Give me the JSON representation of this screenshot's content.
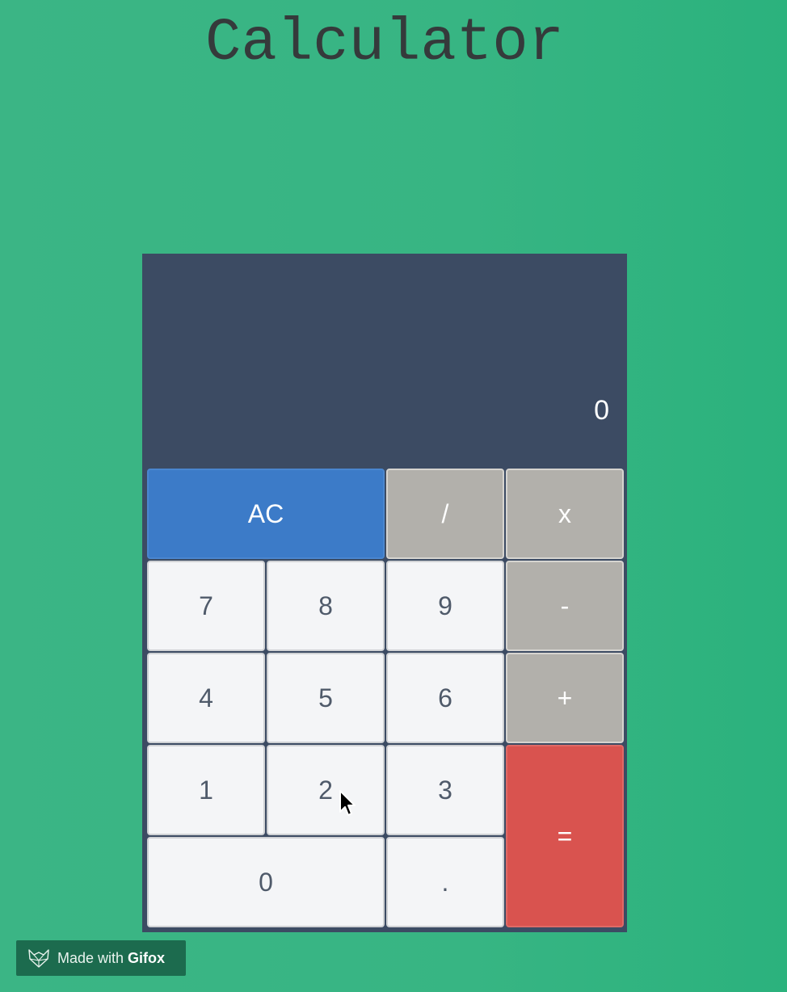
{
  "page": {
    "title": "Calculator"
  },
  "calculator": {
    "display_value": "0",
    "keys": {
      "clear": "AC",
      "divide": "/",
      "multiply": "x",
      "subtract": "-",
      "add": "+",
      "equals": "=",
      "decimal": ".",
      "seven": "7",
      "eight": "8",
      "nine": "9",
      "four": "4",
      "five": "5",
      "six": "6",
      "one": "1",
      "two": "2",
      "three": "3",
      "zero": "0"
    }
  },
  "badge": {
    "prefix": "Made with",
    "brand": "Gifox"
  },
  "colors": {
    "background": "#37b583",
    "calculator_body": "#3c4b63",
    "clear_key": "#3c7bc8",
    "operator_key": "#b2b0ab",
    "equals_key": "#d9534f",
    "number_key": "#f4f5f7",
    "title_text": "#353a3b"
  },
  "icons": {
    "cursor": "arrow-cursor-icon",
    "badge_logo": "fox-icon"
  }
}
